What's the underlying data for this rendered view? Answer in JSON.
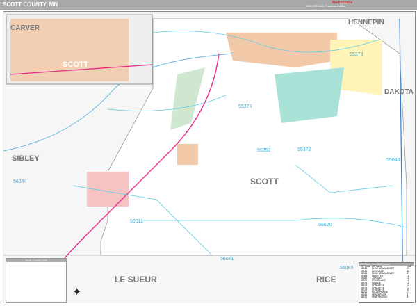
{
  "header": {
    "title": "SCOTT COUNTY, MN",
    "edition": "2020 ZIP Code Premium Edition",
    "logo": "Marketmaps"
  },
  "counties": {
    "carver": "CARVER",
    "hennepin": "HENNEPIN",
    "dakota": "DAKOTA",
    "sibley": "SIBLEY",
    "scott": "SCOTT",
    "inset_scott": "SCOTT",
    "le_sueur": "LE SUEUR",
    "rice": "RICE"
  },
  "zip_labels": [
    "55378",
    "55379",
    "55352",
    "55372",
    "56044",
    "55044",
    "56011",
    "55020",
    "56071",
    "55088"
  ],
  "legend": {
    "title": "Scott County, MN"
  },
  "index": {
    "title": "ZIP Code Index/Grid Locator",
    "headers": [
      "ZIP Code",
      "ZIP Name",
      "Grid"
    ],
    "rows": [
      [
        "55020",
        "ELKO NEW MARKET",
        "C5"
      ],
      [
        "55044",
        "LAKEVILLE",
        "B8"
      ],
      [
        "55054",
        "ELKO NEW MARKET",
        "B7"
      ],
      [
        "55088",
        "WEBSTER",
        "L8"
      ],
      [
        "55352",
        "JORDAN",
        "L6"
      ],
      [
        "55372",
        "PRIOR LAKE",
        "L5"
      ],
      [
        "55378",
        "SAVAGE",
        "L2"
      ],
      [
        "55379",
        "SHAKOPEE",
        "C2"
      ],
      [
        "55379",
        "SHAKOPEE",
        "C3"
      ],
      [
        "55379",
        "SHAKOPEE",
        "I5"
      ],
      [
        "56011",
        "BELLE PLAINE",
        "C7"
      ],
      [
        "56044",
        "HENDERSON",
        "B7"
      ],
      [
        "56071",
        "NEW PRAGUE",
        "B7"
      ]
    ]
  }
}
